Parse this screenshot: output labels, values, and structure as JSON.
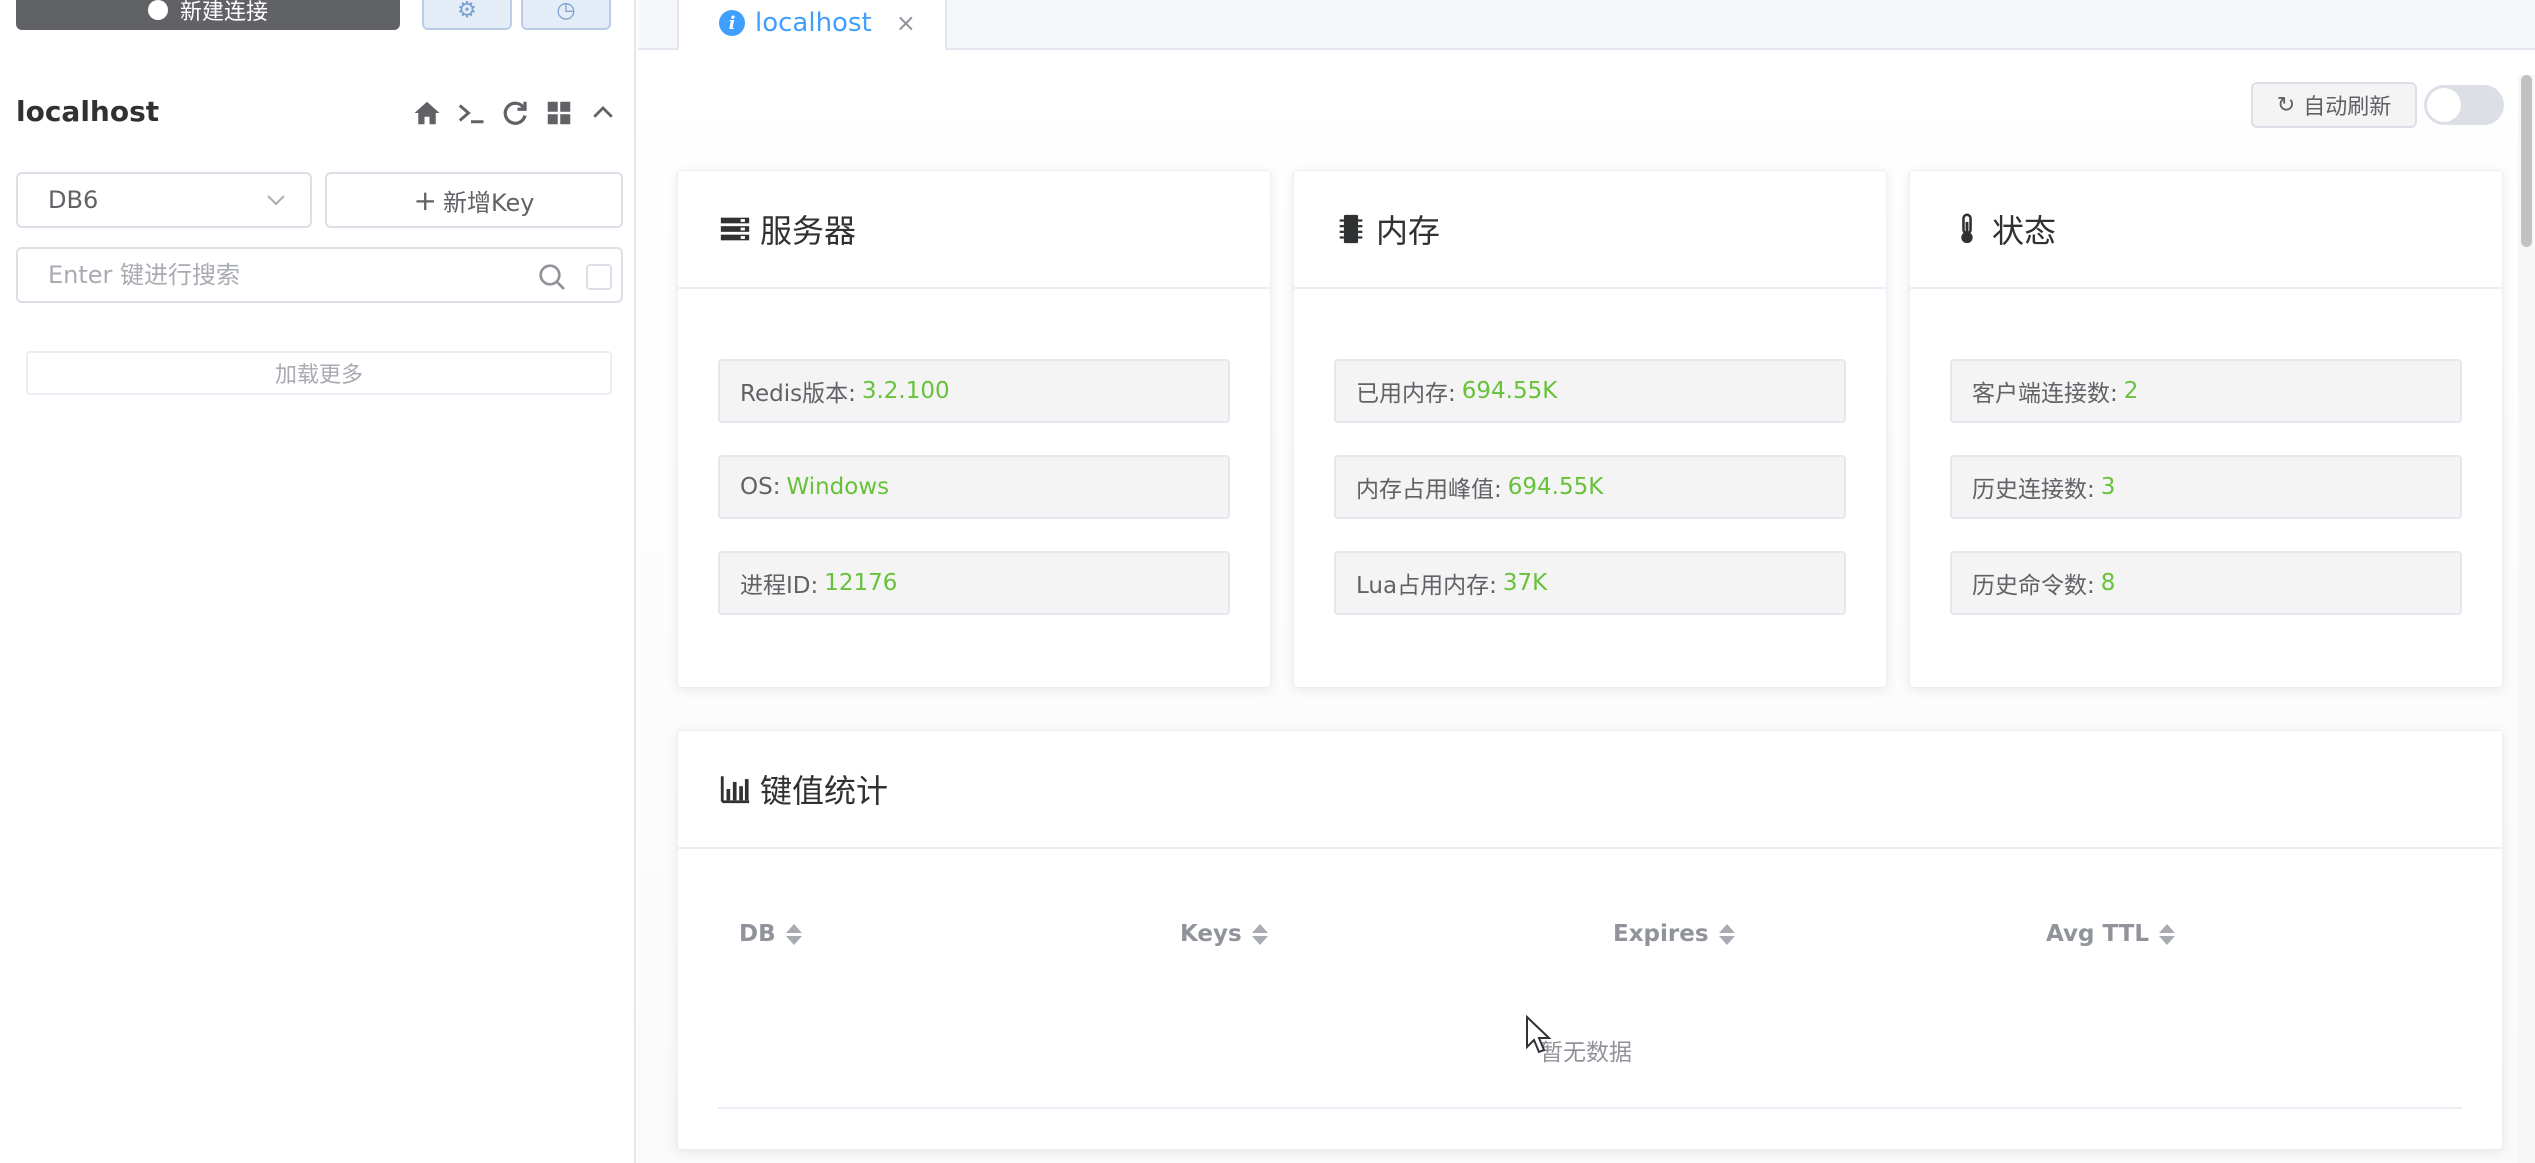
{
  "sidebar": {
    "new_connection_label": "新建连接",
    "connection_name": "localhost",
    "db_select_value": "DB6",
    "new_key_label": "新增Key",
    "search_placeholder": "Enter 键进行搜索",
    "load_more_label": "加载更多",
    "tool_icons": [
      "home-icon",
      "terminal-icon",
      "refresh-icon",
      "grid-icon",
      "collapse-icon"
    ]
  },
  "tabs": [
    {
      "label": "localhost",
      "icon": "info-icon",
      "active": true
    }
  ],
  "toolbar": {
    "auto_refresh_label": "自动刷新",
    "auto_refresh_on": false
  },
  "cards": {
    "server": {
      "title": "服务器",
      "items": [
        {
          "label": "Redis版本:",
          "value": "3.2.100"
        },
        {
          "label": "OS:",
          "value": "Windows"
        },
        {
          "label": "进程ID:",
          "value": "12176"
        }
      ]
    },
    "memory": {
      "title": "内存",
      "items": [
        {
          "label": "已用内存:",
          "value": "694.55K"
        },
        {
          "label": "内存占用峰值:",
          "value": "694.55K"
        },
        {
          "label": "Lua占用内存:",
          "value": "37K"
        }
      ]
    },
    "status": {
      "title": "状态",
      "items": [
        {
          "label": "客户端连接数:",
          "value": "2"
        },
        {
          "label": "历史连接数:",
          "value": "3"
        },
        {
          "label": "历史命令数:",
          "value": "8"
        }
      ]
    }
  },
  "key_stats": {
    "title": "键值统计",
    "columns": [
      "DB",
      "Keys",
      "Expires",
      "Avg TTL"
    ],
    "empty_text": "暂无数据"
  },
  "colors": {
    "accent": "#409eff",
    "value_green": "#67c23a",
    "dark_button": "#606266"
  }
}
